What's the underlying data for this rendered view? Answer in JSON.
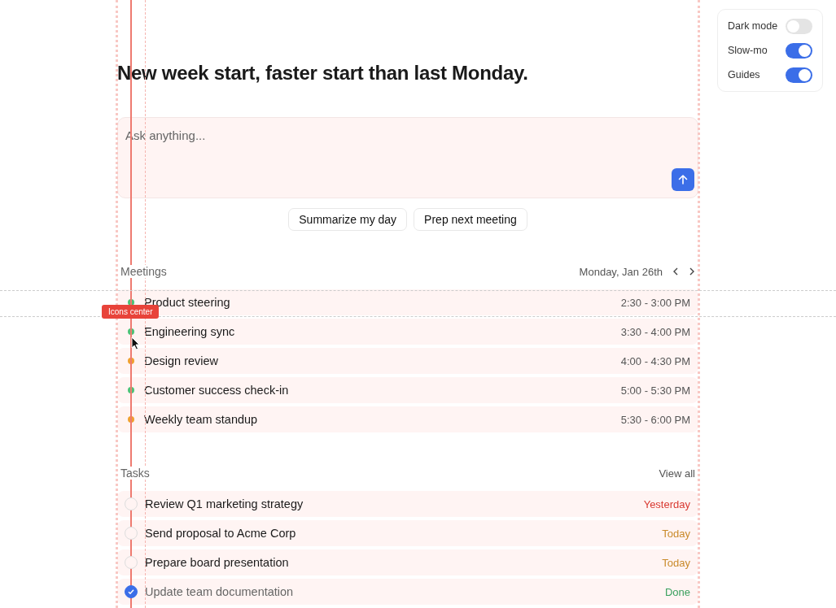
{
  "settings": [
    {
      "label": "Dark mode",
      "on": false,
      "kind": "dark"
    },
    {
      "label": "Slow-mo",
      "on": true,
      "kind": "slowmo"
    },
    {
      "label": "Guides",
      "on": true,
      "kind": "guides"
    }
  ],
  "guides": {
    "label": "Icons center"
  },
  "heading": "New week start, faster start than last Monday.",
  "prompt": {
    "placeholder": "Ask anything..."
  },
  "suggestions": [
    "Summarize my day",
    "Prep next meeting"
  ],
  "meetings": {
    "title": "Meetings",
    "date": "Monday, Jan 26th",
    "items": [
      {
        "name": "Product steering",
        "time": "2:30 - 3:00 PM",
        "color": "#4cc277"
      },
      {
        "name": "Engineering sync",
        "time": "3:30 - 4:00 PM",
        "color": "#4cc277"
      },
      {
        "name": "Design review",
        "time": "4:00 - 4:30 PM",
        "color": "#f0a030"
      },
      {
        "name": "Customer success check-in",
        "time": "5:00 - 5:30 PM",
        "color": "#4cc277"
      },
      {
        "name": "Weekly team standup",
        "time": "5:30 - 6:00 PM",
        "color": "#f0a030"
      }
    ]
  },
  "tasks": {
    "title": "Tasks",
    "link": "View all",
    "items": [
      {
        "name": "Review Q1 marketing strategy",
        "due": "Yesterday",
        "color": "#d93a32",
        "checked": false
      },
      {
        "name": "Send proposal to Acme Corp",
        "due": "Today",
        "color": "#c98a2a",
        "checked": false
      },
      {
        "name": "Prepare board presentation",
        "due": "Today",
        "color": "#c98a2a",
        "checked": false
      },
      {
        "name": "Update team documentation",
        "due": "Done",
        "color": "#3aa05e",
        "checked": true
      }
    ]
  }
}
